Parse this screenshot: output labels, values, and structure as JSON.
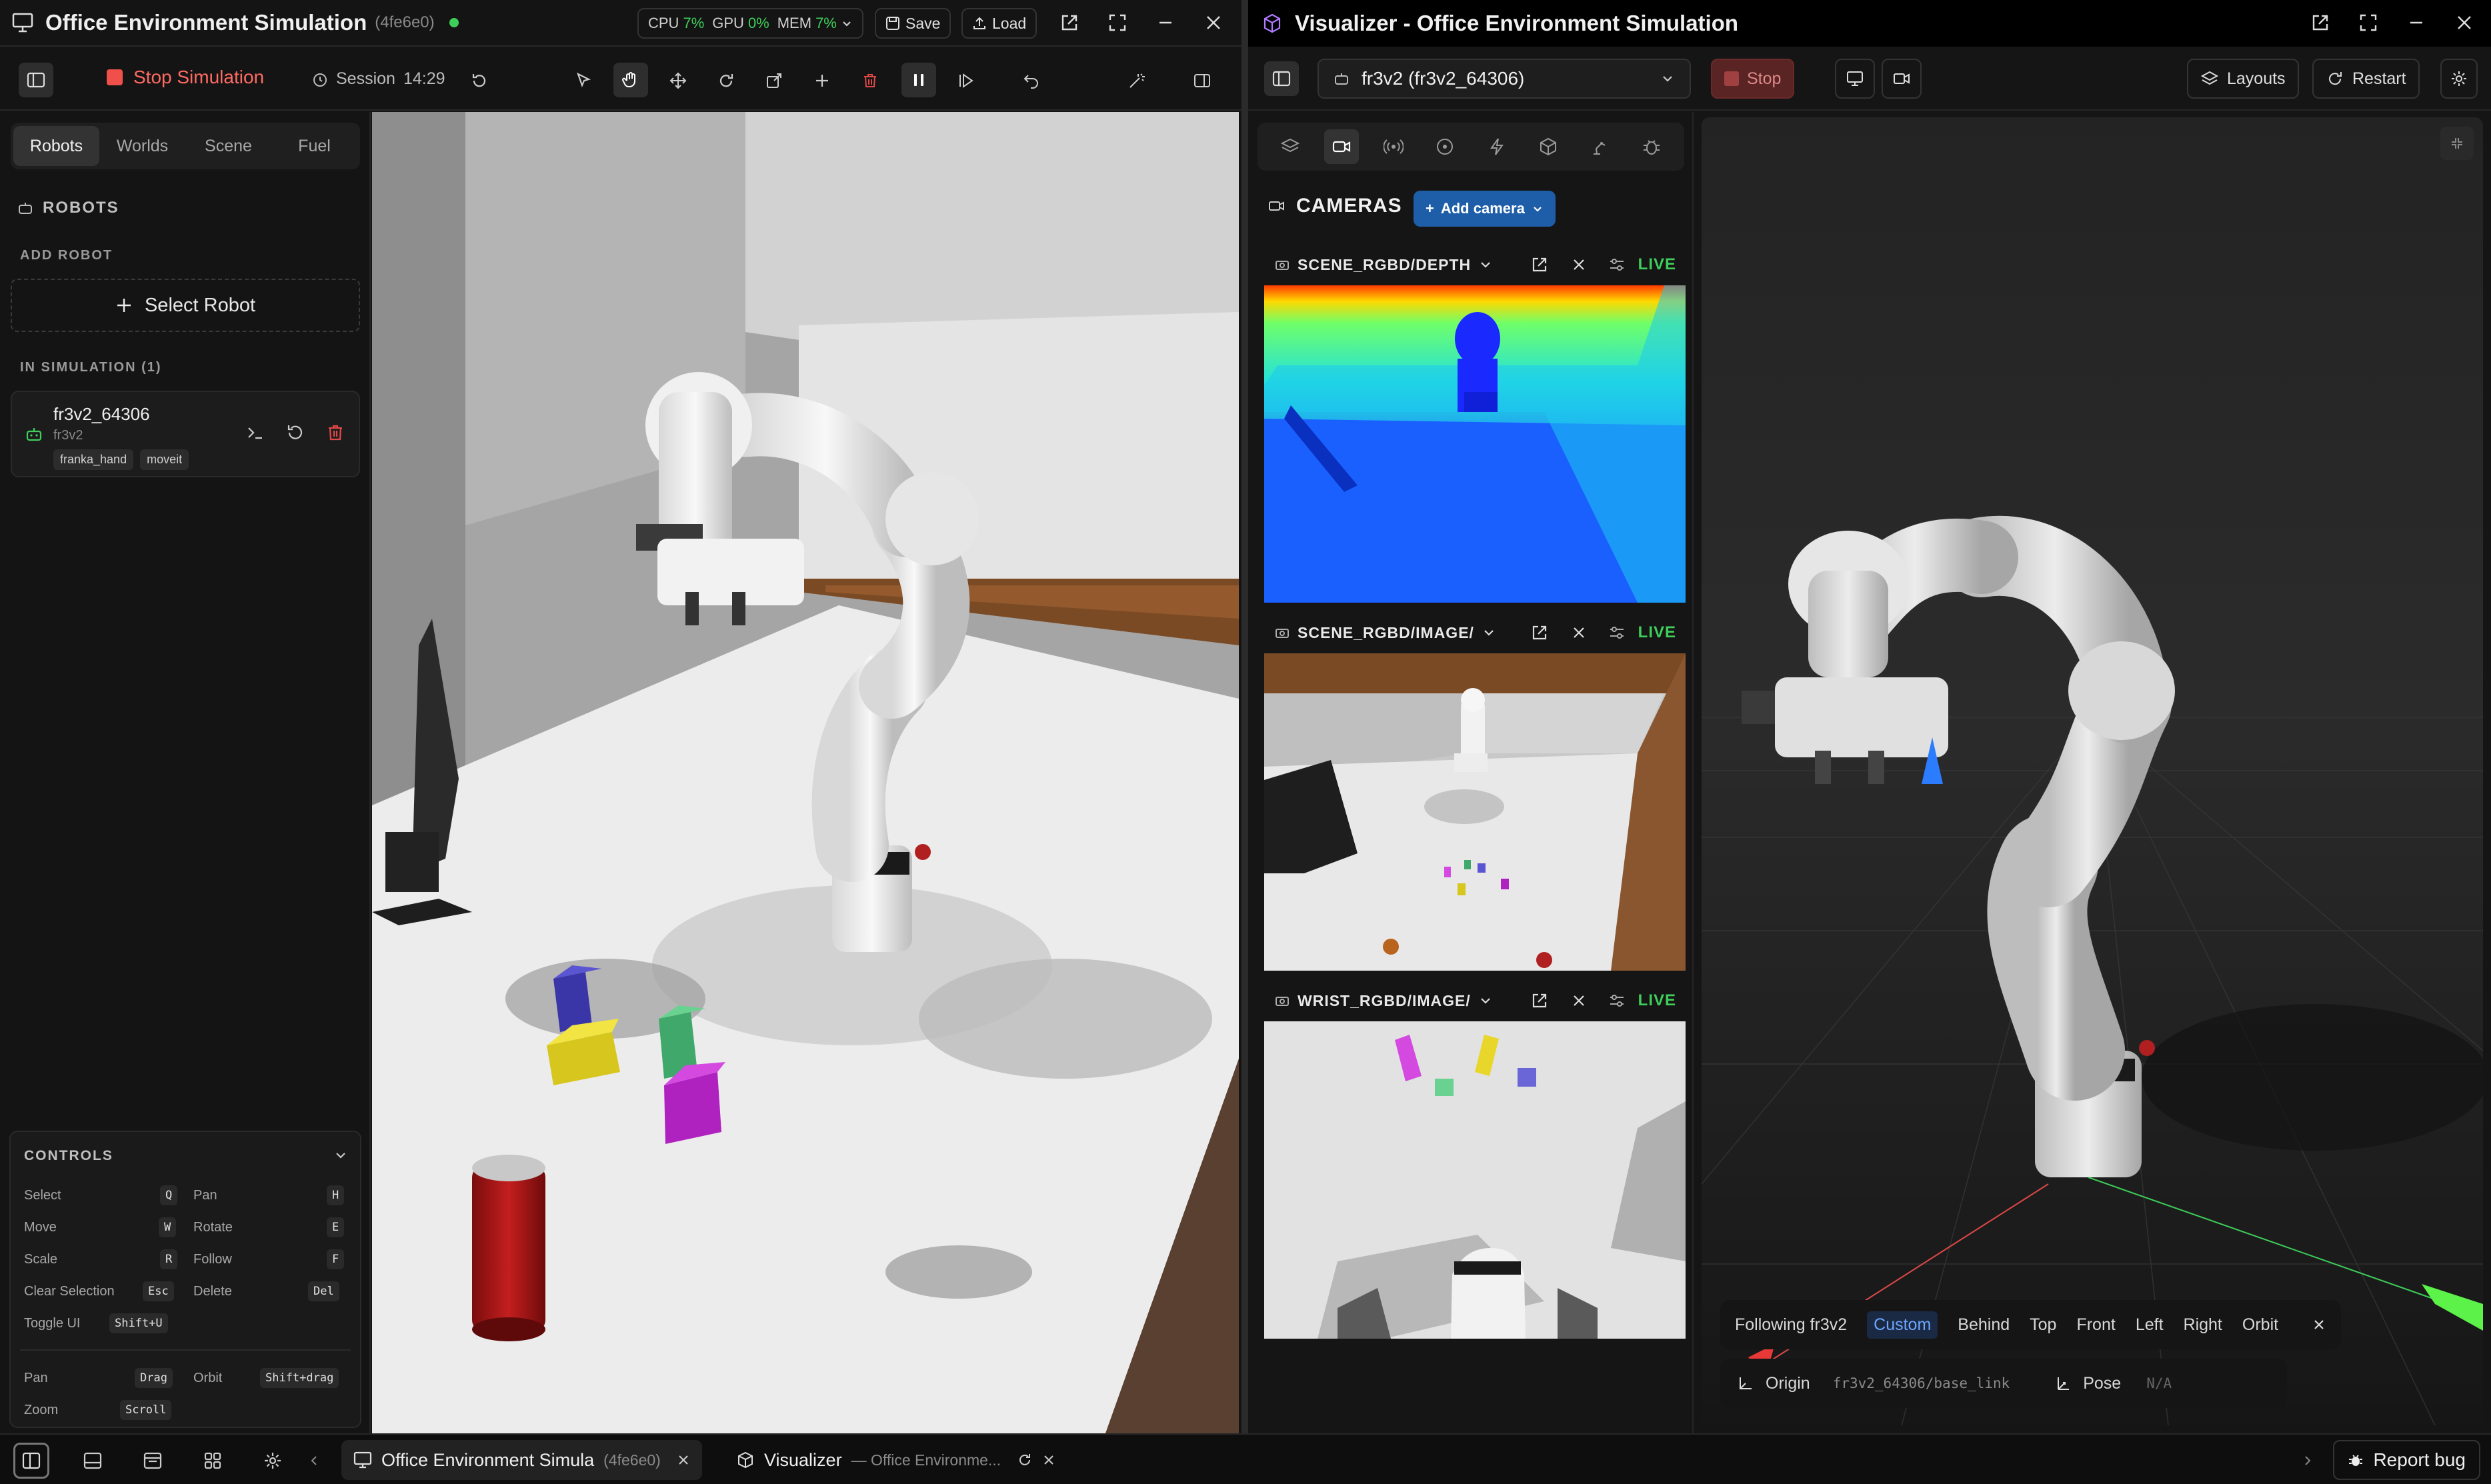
{
  "left_window": {
    "title": "Office Environment Simulation",
    "session_id": "(4fe6e0)",
    "stats": {
      "cpu_label": "CPU",
      "cpu": "7%",
      "gpu_label": "GPU",
      "gpu": "0%",
      "mem_label": "MEM",
      "mem": "7%"
    },
    "save_label": "Save",
    "load_label": "Load",
    "stop_simulation_label": "Stop Simulation",
    "session_label": "Session",
    "session_time": "14:29",
    "tabs": [
      "Robots",
      "Worlds",
      "Scene",
      "Fuel"
    ],
    "robots_heading": "ROBOTS",
    "add_robot_label": "ADD ROBOT",
    "select_robot_label": "Select Robot",
    "in_simulation_label": "IN SIMULATION (1)",
    "robot": {
      "name": "fr3v2_64306",
      "type": "fr3v2",
      "tags": [
        "franka_hand",
        "moveit"
      ]
    },
    "controls": {
      "heading": "CONTROLS",
      "rows": [
        {
          "label": "Select",
          "key": "Q",
          "label2": "Pan",
          "key2": "H"
        },
        {
          "label": "Move",
          "key": "W",
          "label2": "Rotate",
          "key2": "E"
        },
        {
          "label": "Scale",
          "key": "R",
          "label2": "Follow",
          "key2": "F"
        },
        {
          "label": "Clear Selection",
          "key": "Esc",
          "label2": "Delete",
          "key2": "Del"
        },
        {
          "label": "Toggle UI",
          "key": "Shift+U"
        }
      ],
      "mouse": [
        {
          "label": "Pan",
          "key": "Drag",
          "label2": "Orbit",
          "key2": "Shift+drag"
        },
        {
          "label": "Zoom",
          "key": "Scroll"
        }
      ]
    }
  },
  "right_window": {
    "title": "Visualizer - Office Environment Simulation",
    "robot_select": "fr3v2 (fr3v2_64306)",
    "stop_label": "Stop",
    "layouts_label": "Layouts",
    "restart_label": "Restart",
    "cameras_heading": "CAMERAS",
    "add_camera_label": "Add camera",
    "feeds": [
      {
        "name": "SCENE_RGBD/DEPTH",
        "status": "LIVE"
      },
      {
        "name": "SCENE_RGBD/IMAGE/",
        "status": "LIVE"
      },
      {
        "name": "WRIST_RGBD/IMAGE/",
        "status": "LIVE"
      }
    ],
    "follow_bar": {
      "following": "Following fr3v2",
      "modes": [
        "Custom",
        "Behind",
        "Top",
        "Front",
        "Left",
        "Right",
        "Orbit"
      ],
      "active_mode": "Custom"
    },
    "origin_bar": {
      "origin_label": "Origin",
      "frame": "fr3v2_64306/base_link",
      "pose_label": "Pose",
      "pose_value": "N/A"
    }
  },
  "taskbar": {
    "tasks": [
      {
        "title": "Office Environment Simula",
        "id": "(4fe6e0)"
      },
      {
        "title": "Visualizer",
        "subtitle": "— Office Environme..."
      }
    ],
    "report_bug_label": "Report bug"
  }
}
